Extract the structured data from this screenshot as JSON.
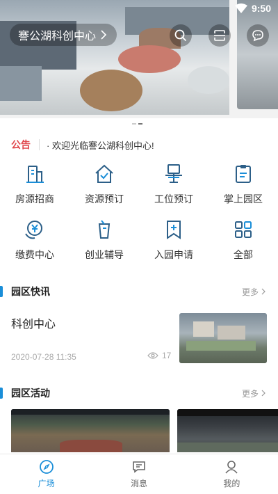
{
  "status_bar": {
    "time": "9:50",
    "wifi_icon": "wifi-icon"
  },
  "banner": {
    "location_label": "謇公湖科创中心",
    "location_chevron_icon": "chevron-right-icon",
    "search_icon": "search-icon",
    "scan_icon": "scan-icon",
    "message_icon": "chat-bubble-icon",
    "slide_count": 2,
    "active_slide": 1
  },
  "notice": {
    "tag": "公告",
    "message": "· 欢迎光临謇公湖科创中心!"
  },
  "services": [
    {
      "label": "房源招商",
      "icon": "building-icon"
    },
    {
      "label": "资源预订",
      "icon": "house-check-icon"
    },
    {
      "label": "工位预订",
      "icon": "workstation-icon"
    },
    {
      "label": "掌上园区",
      "icon": "clipboard-icon"
    },
    {
      "label": "缴费中心",
      "icon": "yuan-payment-icon"
    },
    {
      "label": "创业辅导",
      "icon": "cup-icon"
    },
    {
      "label": "入园申请",
      "icon": "bookmark-add-icon"
    },
    {
      "label": "全部",
      "icon": "grid-all-icon"
    }
  ],
  "news_section": {
    "title": "园区快讯",
    "more_label": "更多",
    "items": [
      {
        "title": "科创中心",
        "date": "2020-07-28 11:35",
        "views": "17"
      }
    ]
  },
  "activity_section": {
    "title": "园区活动",
    "more_label": "更多"
  },
  "tabbar": {
    "tabs": [
      {
        "label": "广场",
        "icon": "compass-icon",
        "active": true
      },
      {
        "label": "消息",
        "icon": "message-icon",
        "active": false
      },
      {
        "label": "我的",
        "icon": "user-icon",
        "active": false
      }
    ]
  },
  "colors": {
    "accent": "#1a8ed8",
    "notice_tag": "#e0474c",
    "text": "#333333",
    "muted": "#999999"
  }
}
